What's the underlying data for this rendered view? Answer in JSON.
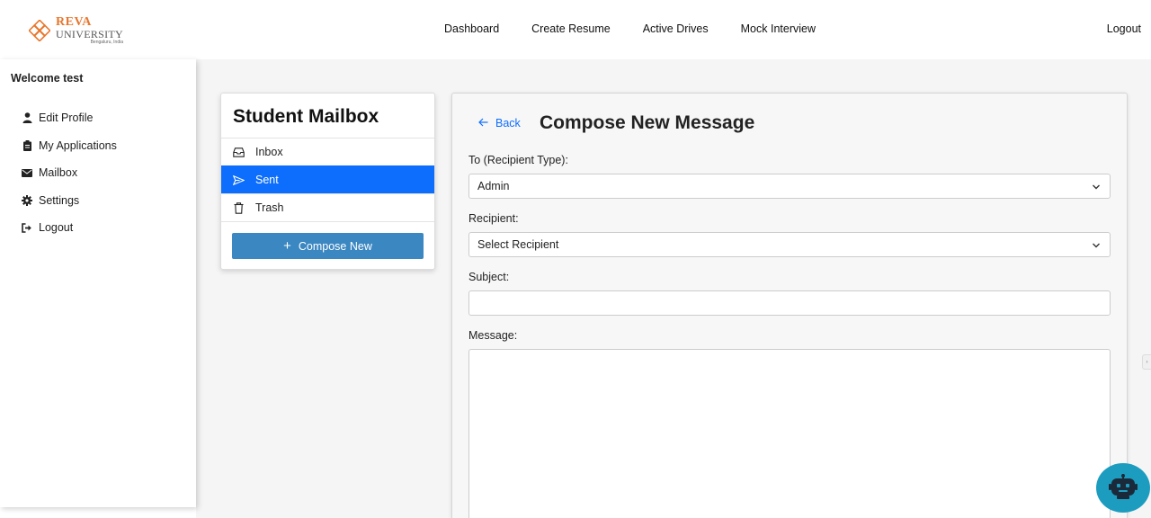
{
  "brand": {
    "name_top": "REVA",
    "name_bottom": "UNIVERSITY",
    "tagline": "Bengaluru, India",
    "accent_color": "#e8762c"
  },
  "nav": {
    "items": [
      {
        "label": "Dashboard"
      },
      {
        "label": "Create Resume"
      },
      {
        "label": "Active Drives"
      },
      {
        "label": "Mock Interview"
      }
    ],
    "logout_label": "Logout"
  },
  "sidebar": {
    "welcome": "Welcome test",
    "items": [
      {
        "label": "Edit Profile",
        "icon": "user-icon"
      },
      {
        "label": "My Applications",
        "icon": "clipboard-icon"
      },
      {
        "label": "Mailbox",
        "icon": "envelope-icon"
      },
      {
        "label": "Settings",
        "icon": "gear-icon"
      },
      {
        "label": "Logout",
        "icon": "sign-out-icon"
      }
    ]
  },
  "mailbox": {
    "title": "Student Mailbox",
    "folders": [
      {
        "label": "Inbox",
        "icon": "inbox-icon",
        "active": false
      },
      {
        "label": "Sent",
        "icon": "send-icon",
        "active": true
      },
      {
        "label": "Trash",
        "icon": "trash-icon",
        "active": false
      }
    ],
    "compose_label": "Compose New",
    "active_color": "#0d6efd",
    "compose_color": "#3a87c2"
  },
  "compose": {
    "back_label": "Back",
    "title": "Compose New Message",
    "recipient_type_label": "To (Recipient Type):",
    "recipient_type_value": "Admin",
    "recipient_label": "Recipient:",
    "recipient_value": "Select Recipient",
    "subject_label": "Subject:",
    "subject_value": "",
    "message_label": "Message:",
    "message_value": ""
  },
  "chatbot": {
    "icon": "robot-icon",
    "color": "#1c9dc0"
  }
}
